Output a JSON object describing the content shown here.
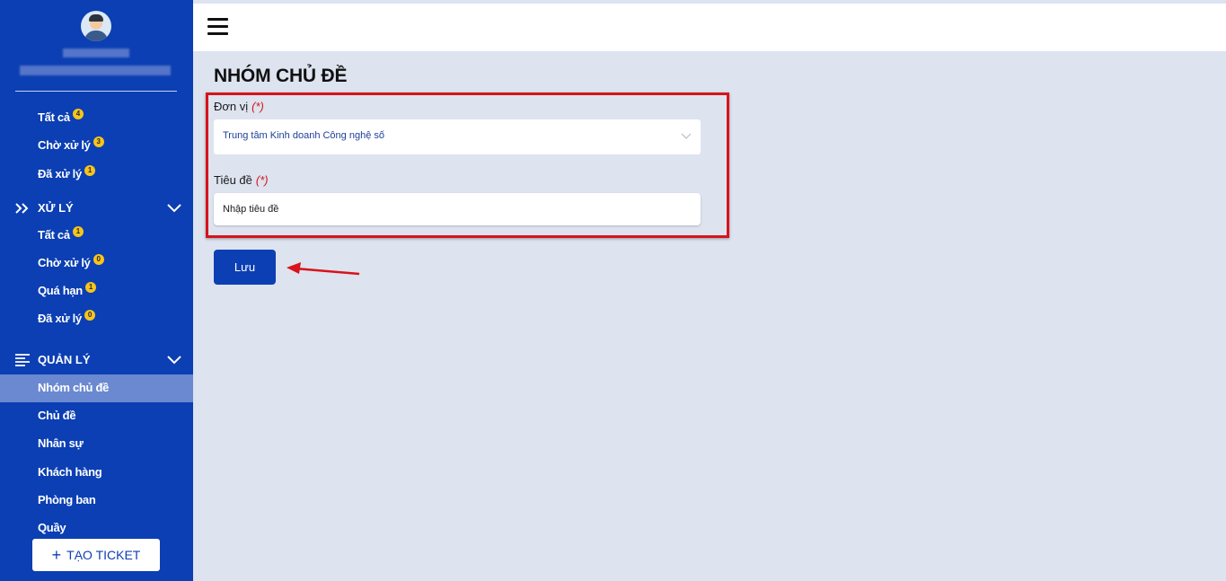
{
  "sidebar": {
    "inbox": [
      {
        "label": "Tất cả",
        "badge": "4"
      },
      {
        "label": "Chờ xử lý",
        "badge": "3"
      },
      {
        "label": "Đã xử lý",
        "badge": "1"
      }
    ],
    "process_section": {
      "title": "XỬ LÝ",
      "items": [
        {
          "label": "Tất cả",
          "badge": "1"
        },
        {
          "label": "Chờ xử lý",
          "badge": "0"
        },
        {
          "label": "Quá hạn",
          "badge": "1"
        },
        {
          "label": "Đã xử lý",
          "badge": "0"
        }
      ]
    },
    "manage_section": {
      "title": "QUẢN LÝ",
      "items": [
        {
          "label": "Nhóm chủ đề",
          "active": true
        },
        {
          "label": "Chủ đề"
        },
        {
          "label": "Nhân sự"
        },
        {
          "label": "Khách hàng"
        },
        {
          "label": "Phòng ban"
        },
        {
          "label": "Quầy"
        }
      ]
    },
    "create_button": "TẠO TICKET"
  },
  "main": {
    "title": "NHÓM CHỦ ĐỀ",
    "unit_label": "Đơn vị",
    "required_mark": "(*)",
    "unit_value": "Trung tâm Kinh doanh Công nghệ số",
    "title_label": "Tiêu đề",
    "title_placeholder": "Nhập tiêu đề",
    "save_button": "Lưu"
  },
  "colors": {
    "sidebar": "#0b3fb3",
    "active_item": "#6b89d0",
    "badge": "#f8c41a",
    "annotation": "#d7131b",
    "background": "#dde3ef"
  }
}
